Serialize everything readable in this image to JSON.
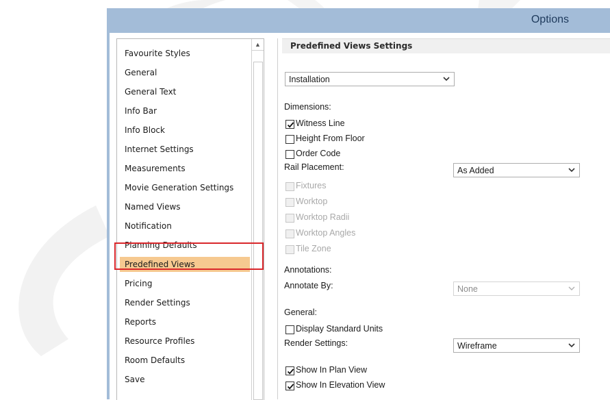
{
  "window": {
    "title": "Options"
  },
  "sidebar": {
    "selected": "Predefined Views",
    "items": [
      "Favourite Styles",
      "General",
      "General Text",
      "Info Bar",
      "Info Block",
      "Internet Settings",
      "Measurements",
      "Movie Generation Settings",
      "Named Views",
      "Notification",
      "Planning Defaults",
      "Predefined Views",
      "Pricing",
      "Render Settings",
      "Reports",
      "Resource Profiles",
      "Room Defaults",
      "Save"
    ]
  },
  "settings": {
    "header": "Predefined Views Settings",
    "view_select": "Installation",
    "dimensions_label": "Dimensions:",
    "witness_line": {
      "label": "Witness Line",
      "checked": true
    },
    "height_from_floor": {
      "label": "Height From Floor",
      "checked": false
    },
    "order_code": {
      "label": "Order Code",
      "checked": false
    },
    "rail_placement_label": "Rail Placement:",
    "rail_placement_value": "As Added",
    "fixtures": {
      "label": "Fixtures",
      "checked": false,
      "enabled": false
    },
    "worktop": {
      "label": "Worktop",
      "checked": false,
      "enabled": false
    },
    "worktop_radii": {
      "label": "Worktop Radii",
      "checked": false,
      "enabled": false
    },
    "worktop_angles": {
      "label": "Worktop Angles",
      "checked": false,
      "enabled": false
    },
    "tile_zone": {
      "label": "Tile Zone",
      "checked": false,
      "enabled": false
    },
    "annotations_label": "Annotations:",
    "annotate_by_label": "Annotate By:",
    "annotate_by_value": "None",
    "general_label": "General:",
    "display_standard_units": {
      "label": "Display Standard Units",
      "checked": false
    },
    "render_settings_label": "Render Settings:",
    "render_settings_value": "Wireframe",
    "show_in_plan_view": {
      "label": "Show In Plan View",
      "checked": true
    },
    "show_in_elevation_view": {
      "label": "Show In Elevation View",
      "checked": true
    }
  },
  "colors": {
    "titlebar": "#a3bcd8",
    "selection": "#f6c990",
    "highlight": "#d9262a"
  }
}
